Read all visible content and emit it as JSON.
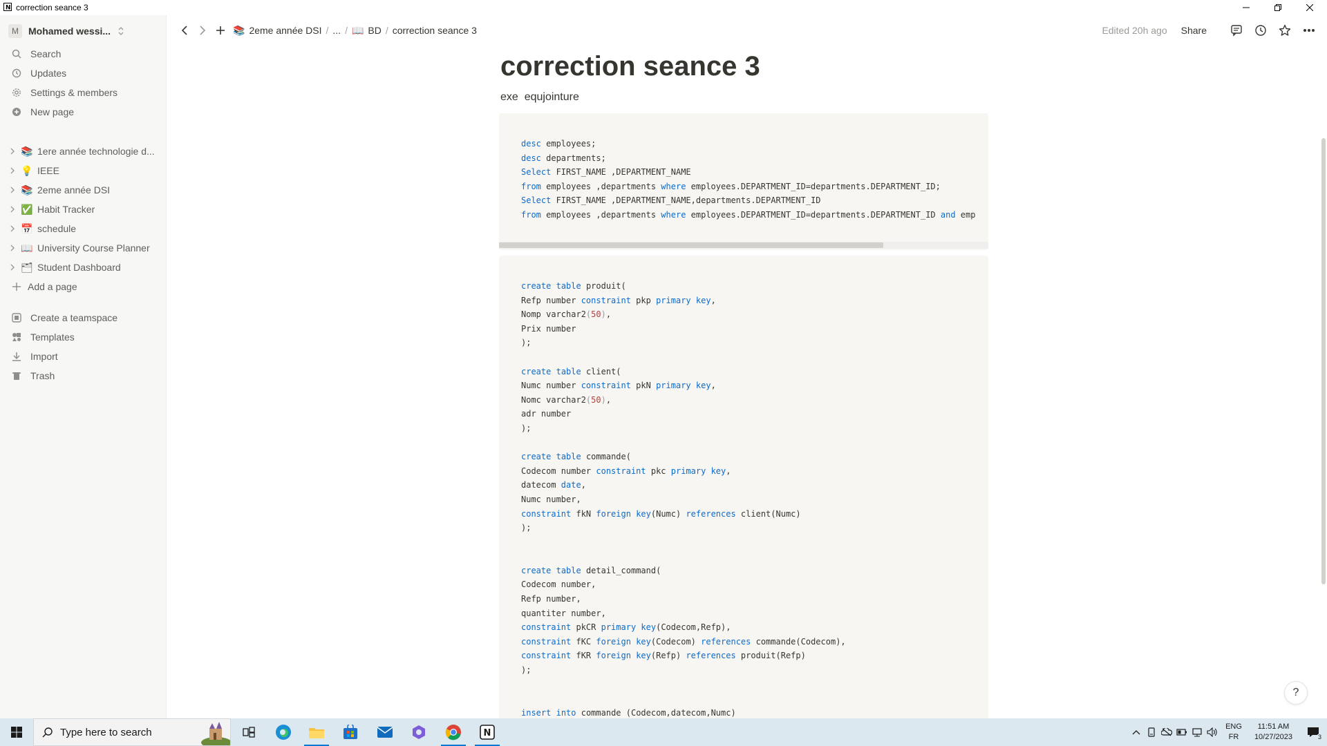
{
  "window": {
    "title": "correction seance 3"
  },
  "sidebar": {
    "workspace": {
      "initial": "M",
      "name": "Mohamed wessi..."
    },
    "top_items": [
      {
        "label": "Search",
        "icon": "search-icon"
      },
      {
        "label": "Updates",
        "icon": "clock-icon"
      },
      {
        "label": "Settings & members",
        "icon": "gear-icon"
      },
      {
        "label": "New page",
        "icon": "plus-circle-icon"
      }
    ],
    "pages": [
      {
        "label": "1ere année technologie d...",
        "emoji": "📚"
      },
      {
        "label": "IEEE",
        "emoji": "💡"
      },
      {
        "label": "2eme année DSI",
        "emoji": "📚"
      },
      {
        "label": "Habit Tracker",
        "emoji": "✅"
      },
      {
        "label": "schedule",
        "emoji": "📅"
      },
      {
        "label": "University Course Planner",
        "emoji": "📖"
      },
      {
        "label": "Student Dashboard",
        "emoji": "🗂"
      }
    ],
    "add_page": "Add a page",
    "bottom_items": [
      {
        "label": "Create a teamspace",
        "icon": "teamspace-icon"
      },
      {
        "label": "Templates",
        "icon": "templates-icon"
      },
      {
        "label": "Import",
        "icon": "import-icon"
      },
      {
        "label": "Trash",
        "icon": "trash-icon"
      }
    ]
  },
  "topbar": {
    "breadcrumbs": [
      "2eme année DSI",
      "...",
      "BD",
      "correction seance 3"
    ],
    "edited": "Edited 20h ago",
    "share": "Share"
  },
  "page": {
    "title": "correction seance 3",
    "subtitle": "exe  equjointure",
    "code_block_1": [
      "desc employees;",
      "desc departments;",
      "Select FIRST_NAME ,DEPARTMENT_NAME",
      "from employees ,departments where employees.DEPARTMENT_ID=departments.DEPARTMENT_ID;",
      "Select FIRST_NAME ,DEPARTMENT_NAME,departments.DEPARTMENT_ID",
      "from employees ,departments where employees.DEPARTMENT_ID=departments.DEPARTMENT_ID and emp"
    ],
    "code_block_2": [
      "create table produit(",
      "Refp number constraint pkp primary key,",
      "Nomp varchar2(50),",
      "Prix number",
      ");",
      "",
      "create table client(",
      "Numc number constraint pkN primary key,",
      "Nomc varchar2(50),",
      "adr number",
      ");",
      "",
      "create table commande(",
      "Codecom number constraint pkc primary key,",
      "datecom date,",
      "Numc number,",
      "constraint fkN foreign key(Numc) references client(Numc)",
      ");",
      "",
      "",
      "create table detail_command(",
      "Codecom number,",
      "Refp number,",
      "quantiter number,",
      "constraint pkCR primary key(Codecom,Refp),",
      "constraint fKC foreign key(Codecom) references commande(Codecom),",
      "constraint fKR foreign key(Refp) references produit(Refp)",
      ");",
      "",
      "",
      "insert into commande (Codecom,datecom,Numc)"
    ],
    "help": "?"
  },
  "taskbar": {
    "search_placeholder": "Type here to search",
    "lang_top": "ENG",
    "lang_bottom": "FR",
    "time": "11:51 AM",
    "date": "10/27/2023",
    "notif_count": "3",
    "accent": "#0078d4"
  }
}
